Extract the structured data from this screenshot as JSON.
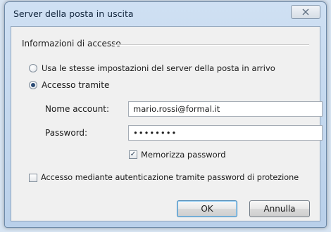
{
  "window": {
    "title": "Server della posta in uscita"
  },
  "group": {
    "label": "Informazioni di accesso"
  },
  "radios": {
    "same_settings": {
      "label": "Usa le stesse impostazioni del server della posta in arrivo",
      "checked": false
    },
    "login_with": {
      "label": "Accesso tramite",
      "checked": true
    }
  },
  "fields": {
    "account": {
      "label": "Nome account:",
      "value": "mario.rossi@formal.it"
    },
    "password": {
      "label": "Password:",
      "value": "••••••••"
    }
  },
  "checkboxes": {
    "remember": {
      "label": "Memorizza password",
      "checked": true,
      "mark": "✓"
    },
    "spa": {
      "label": "Accesso mediante autenticazione tramite password di protezione",
      "checked": false,
      "mark": ""
    }
  },
  "buttons": {
    "ok": "OK",
    "cancel": "Annulla"
  },
  "icons": {
    "close": "close-icon"
  }
}
